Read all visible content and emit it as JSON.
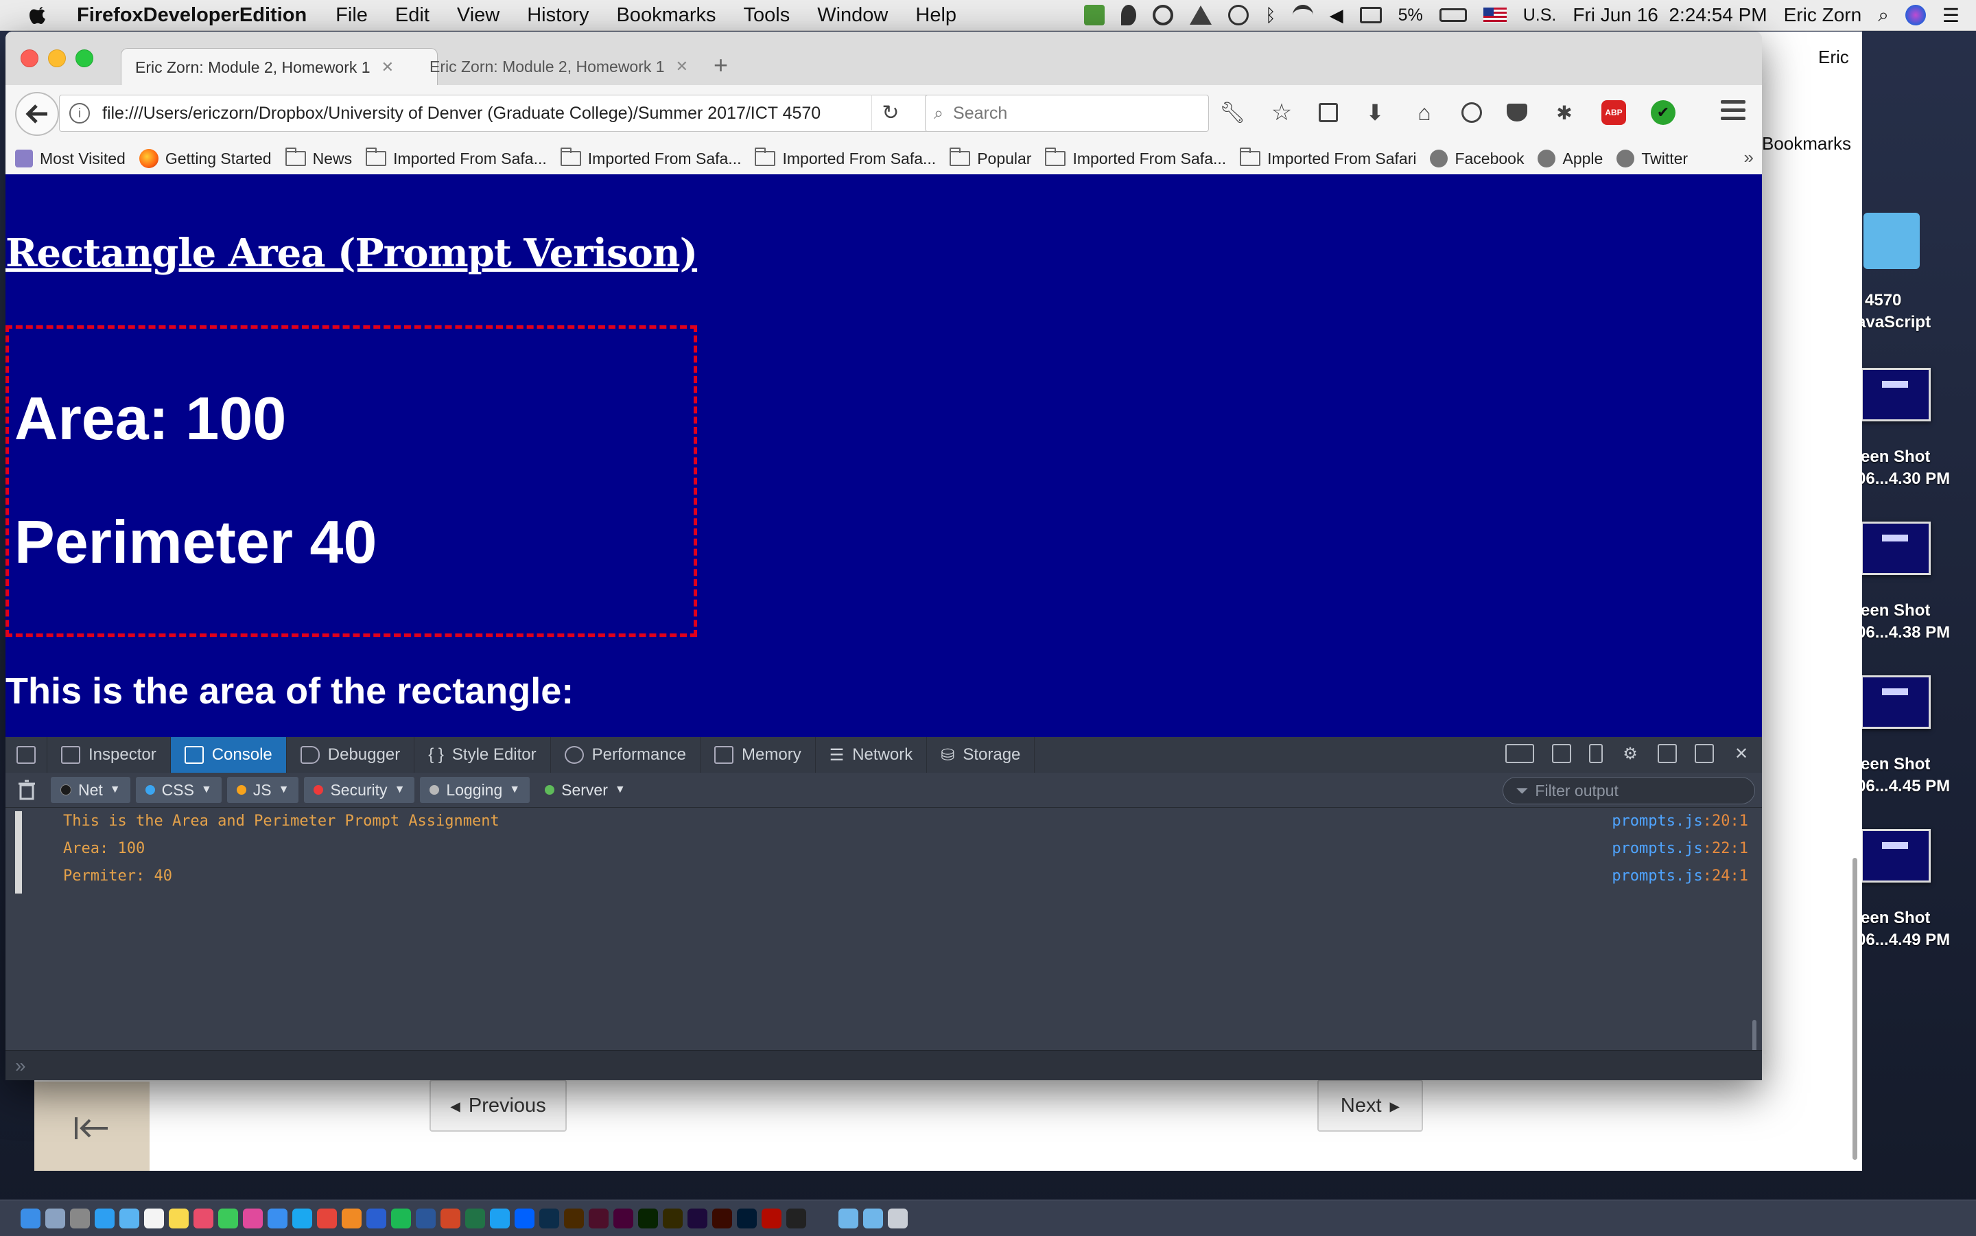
{
  "menubar": {
    "app_name": "FirefoxDeveloperEdition",
    "menus": [
      "File",
      "Edit",
      "View",
      "History",
      "Bookmarks",
      "Tools",
      "Window",
      "Help"
    ],
    "battery": "5%",
    "input_source": "U.S.",
    "datetime": "Fri Jun 16  2:24:54 PM",
    "user": "Eric Zorn"
  },
  "background_page": {
    "top_right_text": "Eric",
    "bookmarks_label": "Bookmarks",
    "previous_label": "Previous",
    "next_label": "Next"
  },
  "desktop": {
    "folder_line1": "4570",
    "folder_line2": "avaScript",
    "shots": [
      {
        "line1": "een Shot",
        "line2": "06...4.30 PM"
      },
      {
        "line1": "een Shot",
        "line2": "06...4.38 PM"
      },
      {
        "line1": "een Shot",
        "line2": "06...4.45 PM"
      },
      {
        "line1": "een Shot",
        "line2": "06...4.49 PM"
      }
    ]
  },
  "browser": {
    "tabs": [
      {
        "title": "Eric Zorn: Module 2, Homework 1",
        "active": true
      },
      {
        "title": "Eric Zorn: Module 2, Homework 1",
        "active": false
      }
    ],
    "url": "file:///Users/ericzorn/Dropbox/University of Denver (Graduate College)/Summer 2017/ICT 4570",
    "search_placeholder": "Search",
    "bookmarks": [
      {
        "label": "Most Visited",
        "icon": "most-visited"
      },
      {
        "label": "Getting Started",
        "icon": "firefox"
      },
      {
        "label": "News",
        "icon": "folder"
      },
      {
        "label": "Imported From Safa...",
        "icon": "folder"
      },
      {
        "label": "Imported From Safa...",
        "icon": "folder"
      },
      {
        "label": "Imported From Safa...",
        "icon": "folder"
      },
      {
        "label": "Popular",
        "icon": "folder"
      },
      {
        "label": "Imported From Safa...",
        "icon": "folder"
      },
      {
        "label": "Imported From Safari",
        "icon": "folder"
      },
      {
        "label": "Facebook",
        "icon": "globe"
      },
      {
        "label": "Apple",
        "icon": "globe"
      },
      {
        "label": "Twitter",
        "icon": "globe"
      }
    ]
  },
  "page": {
    "title": "Rectangle Area (Prompt Verison)",
    "area_text": "Area: 100",
    "perimeter_text": "Perimeter 40",
    "note": "This is the area of the rectangle:",
    "background_color": "#00008b",
    "border_color": "#e0001b"
  },
  "devtools": {
    "tabs": [
      "Inspector",
      "Console",
      "Debugger",
      "Style Editor",
      "Performance",
      "Memory",
      "Network",
      "Storage"
    ],
    "active_tab": "Console",
    "filters": [
      {
        "label": "Net",
        "color": "#1b1b1b"
      },
      {
        "label": "CSS",
        "color": "#3ba5f0"
      },
      {
        "label": "JS",
        "color": "#f7a31c"
      },
      {
        "label": "Security",
        "color": "#ee3a3a"
      },
      {
        "label": "Logging",
        "color": "#b9b9b9"
      },
      {
        "label": "Server",
        "color": "#5fbb5a"
      }
    ],
    "filter_placeholder": "Filter output",
    "messages": [
      {
        "text": "This is the Area and Perimeter Prompt Assignment",
        "file": "prompts.js",
        "loc": ":20:1"
      },
      {
        "text": "Area: 100",
        "file": "prompts.js",
        "loc": ":22:1"
      },
      {
        "text": "Permiter: 40",
        "file": "prompts.js",
        "loc": ":24:1"
      }
    ]
  }
}
